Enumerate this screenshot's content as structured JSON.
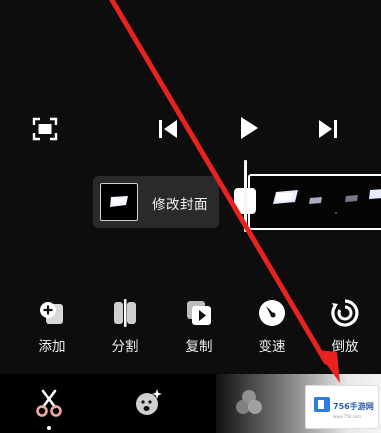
{
  "player": {
    "fullscreen_icon": "fullscreen-icon",
    "prev_icon": "skip-to-start-icon",
    "play_icon": "play-icon",
    "next_icon": "skip-to-end-icon"
  },
  "timeline": {
    "cover_label": "修改封面"
  },
  "tools": [
    {
      "label": "添加",
      "icon": "add-clip-icon"
    },
    {
      "label": "分割",
      "icon": "split-icon"
    },
    {
      "label": "复制",
      "icon": "copy-icon"
    },
    {
      "label": "变速",
      "icon": "speed-icon"
    },
    {
      "label": "倒放",
      "icon": "reverse-icon"
    }
  ],
  "bottom_nav": [
    {
      "name": "cut",
      "icon": "scissors-icon",
      "active": true
    },
    {
      "name": "effects",
      "icon": "sparkle-face-icon",
      "active": false
    },
    {
      "name": "filter",
      "icon": "filter-circles-icon",
      "active": false
    }
  ],
  "watermark": {
    "title": "756手游网",
    "subtitle": "www.756.com"
  },
  "colors": {
    "background": "#0d0d0d",
    "annotation_arrow": "#e8231f",
    "active_icon": "#f2a9a0"
  }
}
